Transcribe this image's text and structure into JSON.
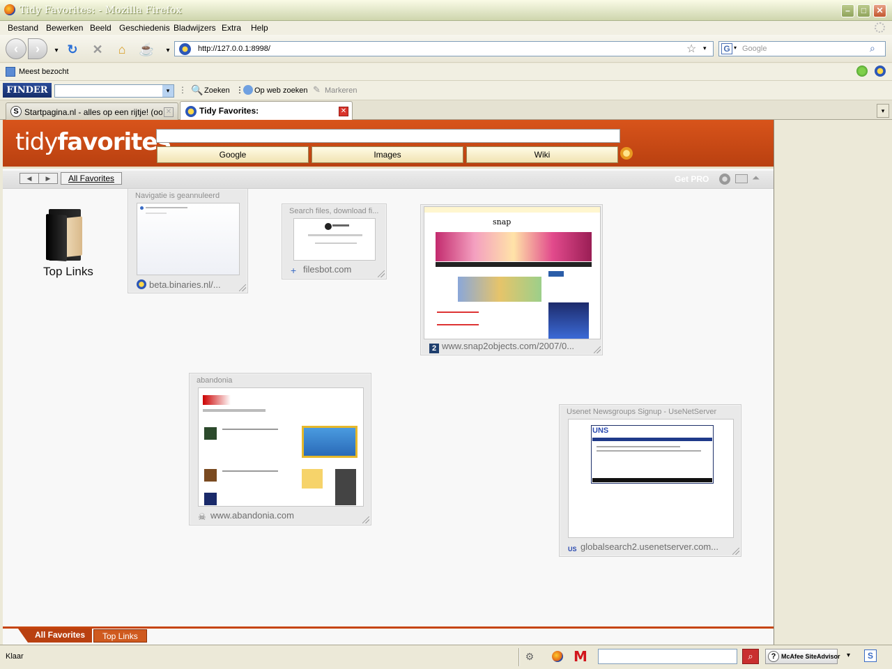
{
  "window": {
    "title": "Tidy Favorites: - Mozilla Firefox"
  },
  "menu": [
    "Bestand",
    "Bewerken",
    "Beeld",
    "Geschiedenis",
    "Bladwijzers",
    "Extra",
    "Help"
  ],
  "nav": {
    "url": "http://127.0.0.1:8998/",
    "search_placeholder": "Google"
  },
  "bookmarks": {
    "most_visited": "Meest bezocht"
  },
  "finder": {
    "brand": "FINDER",
    "search": "Zoeken",
    "web_search": "Op web zoeken",
    "highlight": "Markeren"
  },
  "tabs": [
    {
      "label": "Startpagina.nl - alles op een rijtje! (ook...",
      "active": false
    },
    {
      "label": "Tidy Favorites:",
      "active": true
    }
  ],
  "tidy": {
    "logo_light": "tidy",
    "logo_bold": "favorites",
    "buttons": [
      "Google",
      "Images",
      "Wiki"
    ],
    "all_favorites": "All Favorites",
    "get_pro": "Get PRO",
    "folder_label": "Top Links",
    "tiles": [
      {
        "title": "Navigatie is geannuleerd",
        "footer": "beta.binaries.nl/..."
      },
      {
        "title": "Search files, download fi...",
        "footer": "filesbot.com"
      },
      {
        "title": "",
        "footer": "www.snap2objects.com/2007/0..."
      },
      {
        "title": "abandonia",
        "footer": "www.abandonia.com"
      },
      {
        "title": "Usenet Newsgroups Signup - UseNetServer",
        "footer": "globalsearch2.usenetserver.com..."
      }
    ],
    "bottom_tabs": [
      "All Favorites",
      "Top Links"
    ]
  },
  "status": {
    "text": "Klaar",
    "siteadvisor": "McAfee SiteAdvisor"
  },
  "colors": {
    "accent": "#c6450f",
    "titlebar": "#dfe4c4"
  }
}
